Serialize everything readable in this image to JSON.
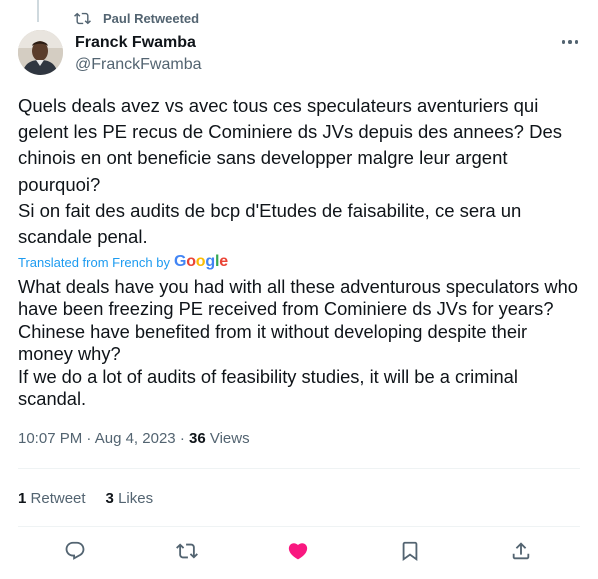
{
  "retweet_banner": {
    "text": "Paul Retweeted",
    "icon": "retweet-icon"
  },
  "author": {
    "name": "Franck Fwamba",
    "handle": "@FranckFwamba",
    "avatar": "avatar-photo"
  },
  "more_icon": "more-horizontal-icon",
  "tweet": {
    "text": "Quels deals avez vs avec tous ces speculateurs aventuriers qui gelent les PE recus de Cominiere ds JVs depuis des annees? Des chinois en ont beneficie sans developper malgre leur argent pourquoi?\nSi on fait des audits de bcp d'Etudes de faisabilite, ce sera un scandale penal.",
    "translated_label": "Translated from French by",
    "translator_logo": "Google",
    "translation": "What deals have you had with all these adventurous speculators who have been freezing PE received from Cominiere ds JVs for years? Chinese have benefited from it without developing despite their money why?\nIf we do a lot of audits of feasibility studies, it will be a criminal scandal."
  },
  "meta": {
    "time": "10:07 PM",
    "date": "Aug 4, 2023",
    "views_count": "36",
    "views_label": "Views"
  },
  "stats": {
    "retweets_count": "1",
    "retweets_label": "Retweet",
    "likes_count": "3",
    "likes_label": "Likes"
  },
  "colors": {
    "accent": "#1d9bf0",
    "like": "#f91880",
    "secondary_text": "#536471",
    "primary_text": "#0f1419"
  },
  "actions": [
    {
      "icon": "reply-icon"
    },
    {
      "icon": "retweet-icon"
    },
    {
      "icon": "like-icon-filled"
    },
    {
      "icon": "bookmark-icon"
    },
    {
      "icon": "share-icon"
    }
  ]
}
